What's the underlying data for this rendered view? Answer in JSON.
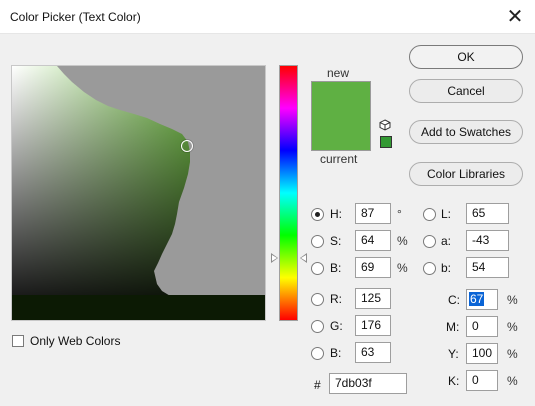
{
  "window": {
    "title": "Color Picker (Text Color)",
    "close_glyph": "✕"
  },
  "preview": {
    "new_label": "new",
    "current_label": "current",
    "new_color": "#5fb043",
    "current_color": "#5fb043",
    "websafe_color": "#339933"
  },
  "buttons": {
    "ok": "OK",
    "cancel": "Cancel",
    "add_to_swatches": "Add to Swatches",
    "color_libraries": "Color Libraries"
  },
  "hsb": {
    "h": {
      "label": "H:",
      "value": "87",
      "unit": "°",
      "selected": true
    },
    "s": {
      "label": "S:",
      "value": "64",
      "unit": "%"
    },
    "b": {
      "label": "B:",
      "value": "69",
      "unit": "%"
    }
  },
  "lab": {
    "l": {
      "label": "L:",
      "value": "65"
    },
    "a": {
      "label": "a:",
      "value": "-43"
    },
    "b": {
      "label": "b:",
      "value": "54"
    }
  },
  "rgb": {
    "r": {
      "label": "R:",
      "value": "125"
    },
    "g": {
      "label": "G:",
      "value": "176"
    },
    "b": {
      "label": "B:",
      "value": "63"
    }
  },
  "cmyk": {
    "c": {
      "label": "C:",
      "value": "67",
      "unit": "%"
    },
    "m": {
      "label": "M:",
      "value": "0",
      "unit": "%"
    },
    "y": {
      "label": "Y:",
      "value": "100",
      "unit": "%"
    },
    "k": {
      "label": "K:",
      "value": "0",
      "unit": "%"
    }
  },
  "hex": {
    "label": "#",
    "value": "7db03f"
  },
  "options": {
    "only_web_colors": "Only Web Colors"
  }
}
